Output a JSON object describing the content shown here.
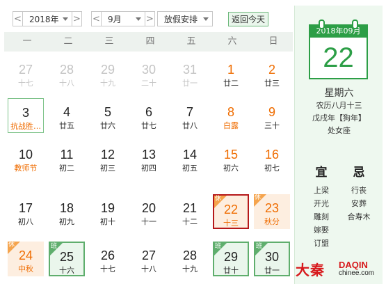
{
  "toolbar": {
    "prev": "<",
    "next": ">",
    "year": "2018年",
    "month": "9月",
    "holiday": "放假安排",
    "today": "返回今天"
  },
  "weekdays": [
    "一",
    "二",
    "三",
    "四",
    "五",
    "六",
    "日"
  ],
  "days": [
    {
      "n": "27",
      "s": "十七",
      "t": "other"
    },
    {
      "n": "28",
      "s": "十八",
      "t": "other"
    },
    {
      "n": "29",
      "s": "十九",
      "t": "other"
    },
    {
      "n": "30",
      "s": "二十",
      "t": "other"
    },
    {
      "n": "31",
      "s": "廿一",
      "t": "other"
    },
    {
      "n": "1",
      "s": "廿二",
      "t": "wkend"
    },
    {
      "n": "2",
      "s": "廿三",
      "t": "wkend"
    },
    {
      "n": "3",
      "s": "抗战胜…",
      "t": "today-mark festival"
    },
    {
      "n": "4",
      "s": "廿五",
      "t": ""
    },
    {
      "n": "5",
      "s": "廿六",
      "t": ""
    },
    {
      "n": "6",
      "s": "廿七",
      "t": ""
    },
    {
      "n": "7",
      "s": "廿八",
      "t": ""
    },
    {
      "n": "8",
      "s": "白露",
      "t": "wkend festival"
    },
    {
      "n": "9",
      "s": "三十",
      "t": "wkend"
    },
    {
      "n": "10",
      "s": "教师节",
      "t": "festival"
    },
    {
      "n": "11",
      "s": "初二",
      "t": ""
    },
    {
      "n": "12",
      "s": "初三",
      "t": ""
    },
    {
      "n": "13",
      "s": "初四",
      "t": ""
    },
    {
      "n": "14",
      "s": "初五",
      "t": ""
    },
    {
      "n": "15",
      "s": "初六",
      "t": "wkend"
    },
    {
      "n": "16",
      "s": "初七",
      "t": "wkend"
    },
    {
      "n": "17",
      "s": "初八",
      "t": ""
    },
    {
      "n": "18",
      "s": "初九",
      "t": ""
    },
    {
      "n": "19",
      "s": "初十",
      "t": ""
    },
    {
      "n": "20",
      "s": "十一",
      "t": ""
    },
    {
      "n": "21",
      "s": "十二",
      "t": ""
    },
    {
      "n": "22",
      "s": "十三",
      "t": "selected rest",
      "badge": "休"
    },
    {
      "n": "23",
      "s": "秋分",
      "t": "rest",
      "badge": "休"
    },
    {
      "n": "24",
      "s": "中秋",
      "t": "rest",
      "badge": "休"
    },
    {
      "n": "25",
      "s": "十六",
      "t": "work",
      "badge": "班"
    },
    {
      "n": "26",
      "s": "十七",
      "t": ""
    },
    {
      "n": "27",
      "s": "十八",
      "t": ""
    },
    {
      "n": "28",
      "s": "十九",
      "t": ""
    },
    {
      "n": "29",
      "s": "廿十",
      "t": "work",
      "badge": "班"
    },
    {
      "n": "30",
      "s": "廿一",
      "t": "work",
      "badge": "班"
    }
  ],
  "panel": {
    "header": "2018年09月",
    "day": "22",
    "weekday": "星期六",
    "lunar": "农历八月十三",
    "ganzhi": "戊戌年【狗年】",
    "zodiac": "处女座",
    "yi_title": "宜",
    "ji_title": "忌",
    "yi": [
      "上梁",
      "开光",
      "雕刻",
      "嫁娶",
      "订盟"
    ],
    "ji": [
      "行丧",
      "安葬",
      "合寿木"
    ]
  },
  "logo": {
    "cn": "大秦",
    "en": "DAQIN",
    "url": "chinee.com"
  },
  "colors": {
    "accent_green": "#2c9e46",
    "weekend_orange": "#ef6c00",
    "selected_border": "#b5181a",
    "rest_bg": "#fdeee0",
    "work_bg": "#eaf6ec",
    "brand_red": "#d7191c"
  }
}
